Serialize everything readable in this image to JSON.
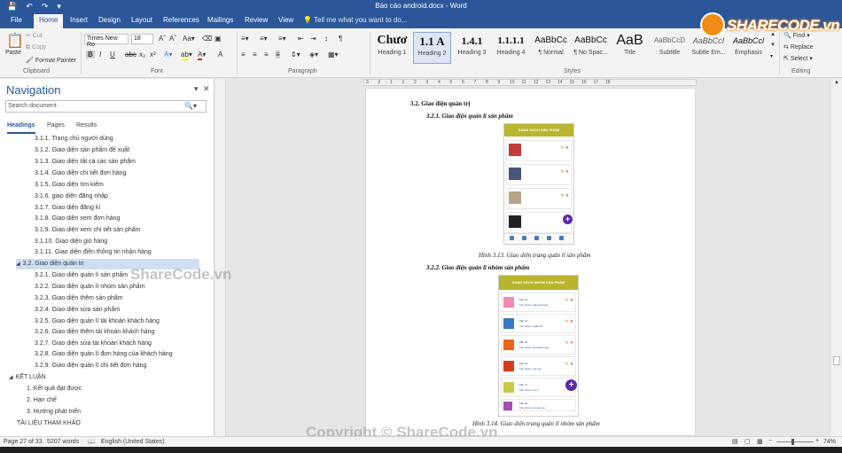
{
  "title": {
    "doc_title": "Báo cáo android.docx - Word"
  },
  "qat": [
    "save-icon",
    "undo-icon",
    "redo-icon",
    "customize-icon"
  ],
  "tabs": [
    {
      "label": "File"
    },
    {
      "label": "Home"
    },
    {
      "label": "Insert"
    },
    {
      "label": "Design"
    },
    {
      "label": "Layout"
    },
    {
      "label": "References"
    },
    {
      "label": "Mailings"
    },
    {
      "label": "Review"
    },
    {
      "label": "View"
    }
  ],
  "tell_me": "Tell me what you want to do...",
  "clipboard": {
    "paste": "Paste",
    "cut": "Cut",
    "copy": "Copy",
    "format_painter": "Format Painter",
    "group": "Clipboard"
  },
  "font": {
    "name": "Times New Ro",
    "size": "18",
    "group": "Font",
    "bold": "B",
    "italic": "I",
    "underline": "U"
  },
  "paragraph": {
    "group": "Paragraph"
  },
  "styles": {
    "group": "Styles",
    "items": [
      {
        "sample": "Chươ",
        "name": "Heading 1"
      },
      {
        "sample": "1.1  A",
        "name": "Heading 2"
      },
      {
        "sample": "1.4.1",
        "name": "Heading 3"
      },
      {
        "sample": "1.1.1.1",
        "name": "Heading 4"
      },
      {
        "sample": "AaBbCc",
        "name": "¶ Normal"
      },
      {
        "sample": "AaBbCc",
        "name": "¶ No Spac..."
      },
      {
        "sample": "AaB",
        "name": "Title"
      },
      {
        "sample": "AaBbCcD",
        "name": "Subtitle"
      },
      {
        "sample": "AaBbCcI",
        "name": "Subtle Em..."
      },
      {
        "sample": "AaBbCcl",
        "name": "Emphasis"
      }
    ]
  },
  "editing": {
    "find": "Find",
    "replace": "Replace",
    "select": "Select",
    "group": "Editing"
  },
  "logo": {
    "text": "SHARECODE.vn"
  },
  "nav": {
    "title": "Navigation",
    "search_placeholder": "Search document",
    "tabs": [
      "Headings",
      "Pages",
      "Results"
    ],
    "items": [
      {
        "label": "3.1.1. Trang chủ người dùng"
      },
      {
        "label": "3.1.2. Giao diện sản phẩm đề xuất"
      },
      {
        "label": "3.1.3. Giao diện tất cả các sản phẩm"
      },
      {
        "label": "3.1.4. Giao diện chi tiết đơn hàng"
      },
      {
        "label": "3.1.5. Giao diện tìm kiếm"
      },
      {
        "label": "3.1.6. giao diện đăng nhập"
      },
      {
        "label": "3.1.7. Giao diện đăng kí"
      },
      {
        "label": "3.1.8. Giao diện xem đơn hàng"
      },
      {
        "label": "3.1.9. Giao diện xem chi tiết sản phẩm"
      },
      {
        "label": "3.1.10. Giao diện giỏ hàng"
      },
      {
        "label": "3.1.11. Giao diện điền thông tin nhận hàng"
      },
      {
        "label": "3.2. Giao diện quản trị"
      },
      {
        "label": "3.2.1. Giao diện quản lí sản phẩm"
      },
      {
        "label": "3.2.2. Giao diện quản lí nhóm sản phẩm"
      },
      {
        "label": "3.2.3. Giao diện thêm sản phẩm"
      },
      {
        "label": "3.2.4. Giao diện sửa sản phẩm"
      },
      {
        "label": "3.2.5. Giao diện quản lí tài khoản khách hàng"
      },
      {
        "label": "3.2.6. Giao diện thêm tài khoản khách hàng"
      },
      {
        "label": "3.2.7. Giao diện sửa tài khoản khách hàng"
      },
      {
        "label": "3.2.8. Giao diện quản lí đơn hàng của khách hàng"
      },
      {
        "label": "3.2.9. Giao diện quản lí chi tiết đơn hàng"
      },
      {
        "label": "KẾT LUẬN"
      },
      {
        "label": "1. Kết quả đạt được"
      },
      {
        "label": "2. Hạn chế"
      },
      {
        "label": "3. Hướng phát triển"
      },
      {
        "label": "TÀI LIỆU THAM KHẢO"
      }
    ]
  },
  "ruler_ticks": [
    "3",
    "2",
    "1",
    "1",
    "2",
    "3",
    "4",
    "5",
    "6",
    "7",
    "8",
    "9",
    "10",
    "11",
    "12",
    "13",
    "14",
    "15",
    "16",
    "17",
    "18"
  ],
  "doc": {
    "h_32": "3.2. Giao diện quản trị",
    "h_321": "3.2.1. Giao diện quản lí sản phẩm",
    "fig1_title": "DANH SÁCH SẢN PHẨM",
    "caption1": "Hình 3.13. Giao diện trang quản lí sản phẩm",
    "h_322": "3.2.2. Giao diện quản lí nhóm sản phẩm",
    "fig2_title": "DANH SÁCH NHÓM SẢN PHẨM",
    "fig2_rows": [
      {
        "id": "Mã: 13",
        "name": "Tên nhóm: giày thể thao",
        "color": "#f08ab5"
      },
      {
        "id": "Mã: 14",
        "name": "Tên nhóm: quần bò",
        "color": "#3b78c2"
      },
      {
        "id": "Mã: 15",
        "name": "Tên nhóm: áo khoác dày",
        "color": "#e8661c"
      },
      {
        "id": "Mã: 16",
        "name": "Tên nhóm: váy nữ",
        "color": "#d83a1c"
      },
      {
        "id": "Mã: 17",
        "name": "Tên nhóm: áo nỉ",
        "color": "#c8c84a"
      },
      {
        "id": "Mã: 18",
        "name": "Tên nhóm: áo vay tay",
        "color": "#a14fb0"
      }
    ],
    "caption2": "Hình 3.14. Giao diện trang quản lí nhóm sản phẩm",
    "fig1_colors": [
      "#c23a3a",
      "#445577",
      "#b8a58a",
      "#222222"
    ]
  },
  "status": {
    "page": "Page 27 of 33",
    "words": "5207 words",
    "lang": "English (United States)",
    "zoom": "74%"
  },
  "watermarks": [
    "ShareCode.vn",
    "Copyright © ShareCode.vn"
  ]
}
